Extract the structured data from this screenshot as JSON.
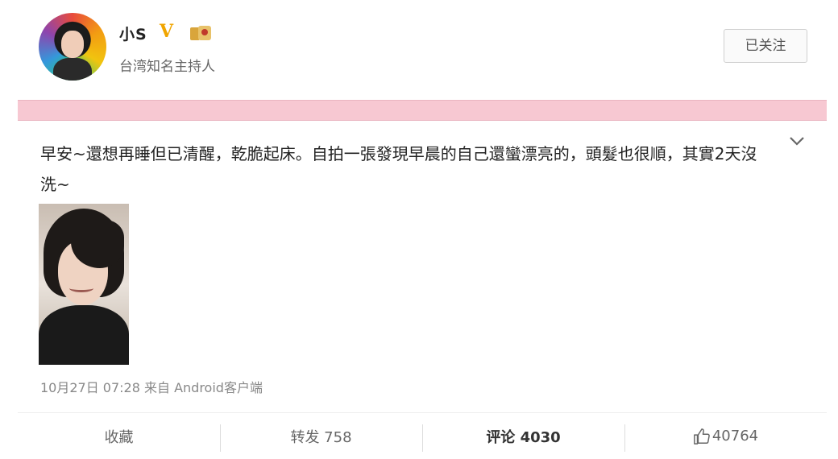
{
  "profile": {
    "name": "小S",
    "verified_mark": "V",
    "subtitle": "台湾知名主持人",
    "follow_button": "已关注"
  },
  "post": {
    "text": "早安~還想再睡但已清醒，乾脆起床。自拍一張發現早晨的自己還蠻漂亮的，頭髮也很順，其實2天沒洗~",
    "meta": "10月27日 07:28 来自 Android客户端"
  },
  "actions": {
    "favorite": "收藏",
    "repost": "转发 758",
    "comment": "评论 4030",
    "like": "40764"
  },
  "colors": {
    "pink_bar": "#f7c8d2",
    "verified": "#f0a500"
  }
}
